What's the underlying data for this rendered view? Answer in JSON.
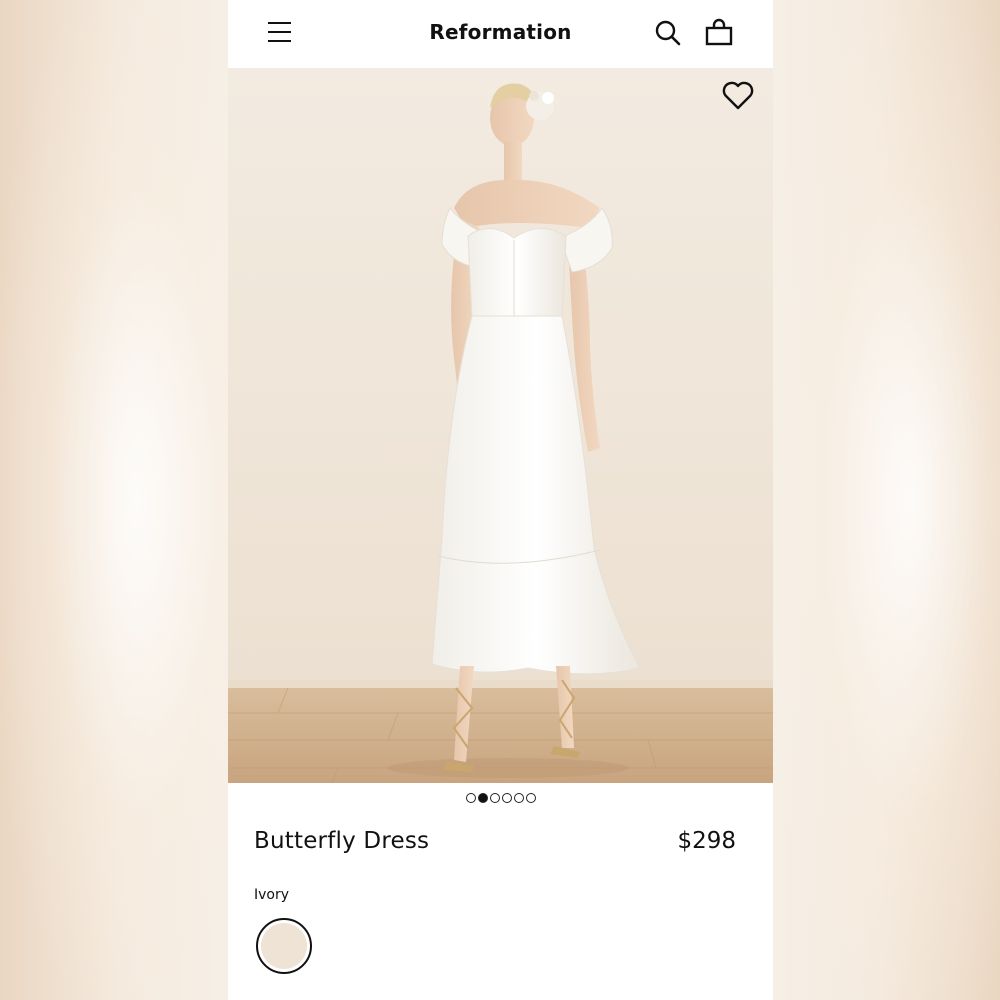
{
  "header": {
    "brand": "Reformation",
    "menu_icon": "hamburger-menu-icon",
    "search_icon": "search-icon",
    "bag_icon": "shopping-bag-icon"
  },
  "product": {
    "name": "Butterfly Dress",
    "price": "$298",
    "color_label": "Ivory",
    "swatch_color": "#efe3d6",
    "wishlist_icon": "heart-icon",
    "image_alt": "Model wearing off-shoulder ivory midi dress with ruffle hem"
  },
  "carousel": {
    "total": 6,
    "active_index": 1
  },
  "colors": {
    "text": "#111111",
    "background": "#ffffff",
    "page_backdrop": "#f6efe6"
  }
}
